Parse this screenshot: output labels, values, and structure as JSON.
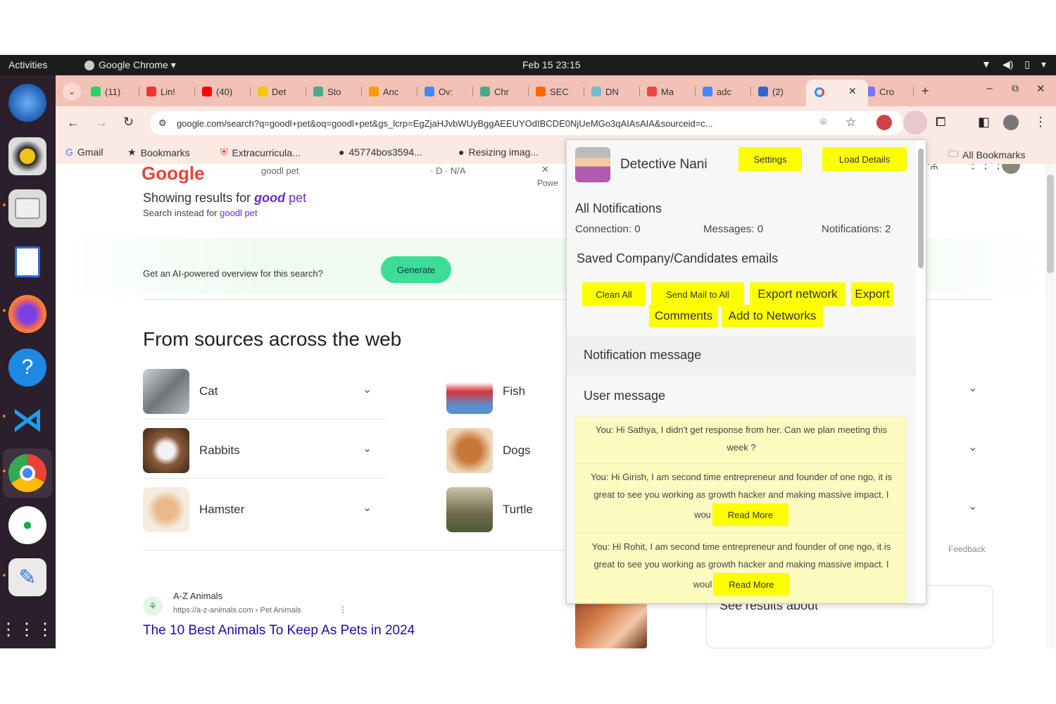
{
  "topbar": {
    "activities": "Activities",
    "app_name": "Google Chrome ▾",
    "clock": "Feb 15  23:15",
    "tray_icons": [
      "wifi-icon",
      "volume-icon",
      "battery-icon",
      "dropdown-icon"
    ]
  },
  "dock": {
    "items": [
      "thunderbird-icon",
      "rhythmbox-icon",
      "files-icon",
      "writer-icon",
      "firefox-icon",
      "help-icon",
      "vscode-icon",
      "chrome-icon",
      "mongodb-icon",
      "text-editor-icon",
      "app-grid-icon"
    ]
  },
  "tabs": [
    {
      "label": "(11)",
      "color": "#25d366"
    },
    {
      "label": "Lin!",
      "color": "#e33"
    },
    {
      "label": "(40)",
      "color": "#f00"
    },
    {
      "label": "Det",
      "color": "#f7c600"
    },
    {
      "label": "Sto",
      "color": "#4a8"
    },
    {
      "label": "Anc",
      "color": "#f90"
    },
    {
      "label": "Ov:",
      "color": "#48f"
    },
    {
      "label": "Chr",
      "color": "#4a8"
    },
    {
      "label": "SEC",
      "color": "#f60"
    },
    {
      "label": "DN",
      "color": "#7bc"
    },
    {
      "label": "Ma",
      "color": "#e44"
    },
    {
      "label": "adc",
      "color": "#48f"
    },
    {
      "label": "(2)",
      "color": "#36c"
    },
    {
      "label": "Cro",
      "color": "#77f"
    }
  ],
  "toolbar": {
    "url": "google.com/search?q=goodl+pet&oq=goodl+pet&gs_lcrp=EgZjaHJvbWUyBggAEEUYOdIBCDE0NjUeMGo3qAIAsAIA&sourceid=c..."
  },
  "bookmarks": {
    "items": [
      "Gmail",
      "Bookmarks",
      "Extracurricula...",
      "45774bos3594...",
      "Resizing imag..."
    ],
    "all_bookmarks": "All Bookmarks"
  },
  "google": {
    "logo": "Google",
    "query": "goodl pet",
    "search_meta": "· D ·   N/A",
    "powered": "Powe",
    "showing_prefix": "Showing results for ",
    "showing_good": "good",
    "showing_pet": " pet",
    "instead_prefix": "Search instead for ",
    "instead_query": "goodl pet",
    "ai_text": "Get an AI-powered overview for this search?",
    "generate": "Generate",
    "from_sources": "From sources across the web",
    "pets_left": [
      "Cat",
      "Rabbits",
      "Hamster"
    ],
    "pets_mid": [
      "Fish",
      "Dogs",
      "Turtle"
    ],
    "feedback": "Feedback",
    "az_name": "A-Z Animals",
    "az_url": "https://a-z-animals.com › Pet Animals",
    "az_title": "The 10 Best Animals To Keep As Pets in 2024",
    "see_results": "See results about"
  },
  "popup": {
    "title": "Detective Nani",
    "settings": "Settings",
    "load_details": "Load Details",
    "all_notifications": "All Notifications",
    "connection": "Connection: 0",
    "messages": "Messages: 0",
    "notifications": "Notifications: 2",
    "saved_title": "Saved Company/Candidates emails",
    "buttons": {
      "clean_all": "Clean All",
      "send_mail": "Send Mail to All",
      "export_network": "Export network",
      "export": "Export",
      "comments": "Comments",
      "add_networks": "Add to Networks"
    },
    "notification_message": "Notification message",
    "user_message": "User message",
    "messages_list": [
      {
        "text": "You: Hi Sathya, I didn't get response from her. Can we plan meeting this week ?",
        "read_more": ""
      },
      {
        "text": "You: Hi Girish, I am second time entrepreneur and founder of one ngo, it is great to see you working as growth hacker and making massive impact. I wou",
        "read_more": "Read More"
      },
      {
        "text": "You: Hi Rohit, I am second time entrepreneur and founder of one ngo, it is great to see you working as growth hacker and making massive impact. I woul",
        "read_more": "Read More"
      }
    ]
  }
}
